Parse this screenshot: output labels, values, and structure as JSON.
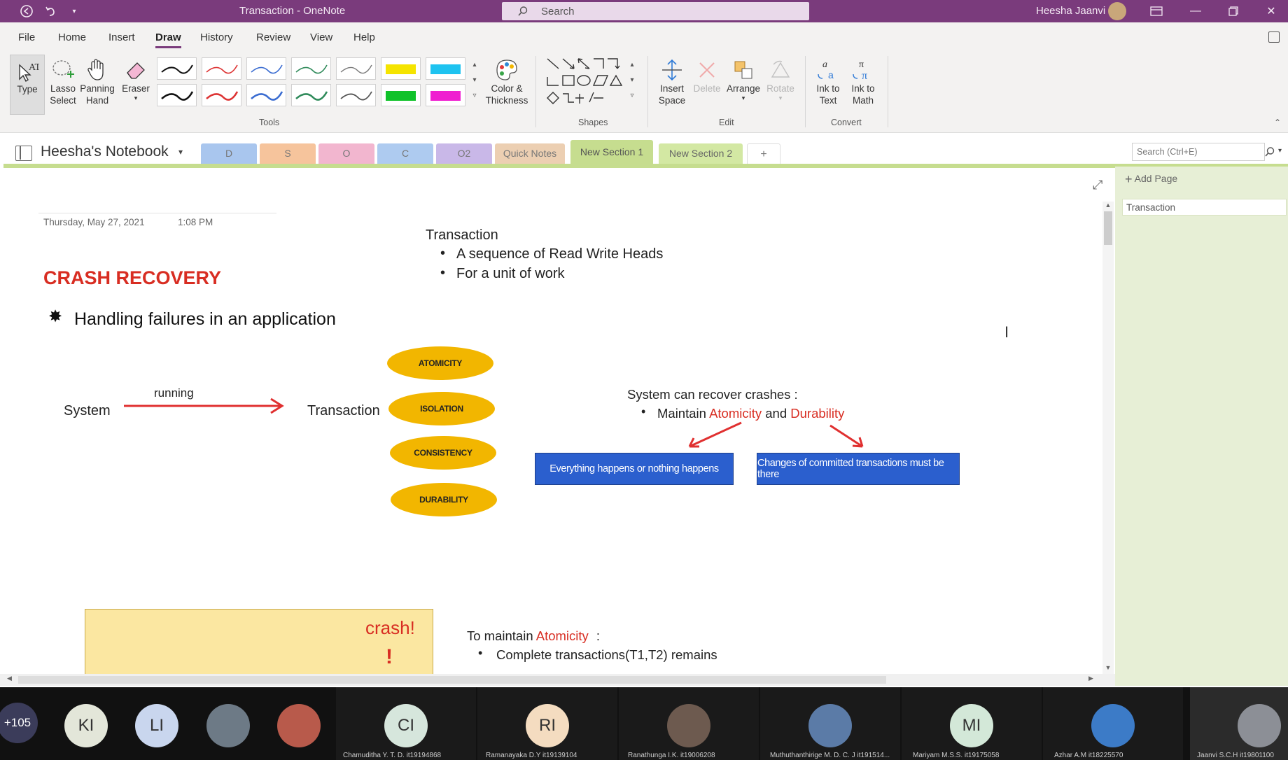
{
  "window": {
    "title": "Transaction - OneNote",
    "search_placeholder": "Search",
    "user_name": "Heesha Jaanvi"
  },
  "menu": [
    "File",
    "Home",
    "Insert",
    "Draw",
    "History",
    "Review",
    "View",
    "Help"
  ],
  "ribbon": {
    "type": "Type",
    "lasso_select": "Lasso Select",
    "panning_hand": "Panning Hand",
    "eraser": "Eraser",
    "color_thickness": "Color & Thickness",
    "insert_space": "Insert Space",
    "delete": "Delete",
    "arrange": "Arrange",
    "rotate": "Rotate",
    "ink_to_text": "Ink to Text",
    "ink_to_math": "Ink to Math",
    "groups": {
      "tools": "Tools",
      "shapes": "Shapes",
      "edit": "Edit",
      "convert": "Convert"
    }
  },
  "notebook": {
    "name": "Heesha's Notebook",
    "sections": [
      {
        "label": "D",
        "color": "#a9c6ee"
      },
      {
        "label": "S",
        "color": "#f6c49c"
      },
      {
        "label": "O",
        "color": "#f2b6cf"
      },
      {
        "label": "C",
        "color": "#aecbf0"
      },
      {
        "label": "O2",
        "color": "#c9b8e8"
      },
      {
        "label": "Quick Notes",
        "color": "#eccfb2"
      },
      {
        "label": "New Section 1",
        "color": "#c6dd8f"
      },
      {
        "label": "New Section 2",
        "color": "#d3e8a3"
      },
      {
        "label": "+",
        "color": "#ffffff"
      }
    ],
    "search_placeholder": "Search (Ctrl+E)"
  },
  "pages_pane": {
    "add_page": "Add Page",
    "pages": [
      "Transaction"
    ]
  },
  "note": {
    "date": "Thursday, May 27, 2021",
    "time": "1:08 PM",
    "title": "CRASH RECOVERY",
    "bullet_main": "Handling failures in an application",
    "transaction_heading": "Transaction",
    "transaction_bullets": [
      "A sequence of Read Write Heads",
      "For a unit of work"
    ],
    "system_label": "System",
    "running_label": "running",
    "transaction_label": "Transaction",
    "acid": [
      "ATOMICITY",
      "ISOLATION",
      "CONSISTENCY",
      "DURABILITY"
    ],
    "recover_heading": "System can recover crashes :",
    "maintain_prefix": "Maintain",
    "atomicity": "Atomicity",
    "and": "and",
    "durability": "Durability",
    "box_atomicity": "Everything happens or nothing happens",
    "box_durability": "Changes of committed transactions must be there",
    "crash_label": "crash!",
    "crash_mark": "!",
    "maintain_atomicity_prefix": "To maintain",
    "maintain_atomicity_word": "Atomicity",
    "maintain_atomicity_suffix": ":",
    "maintain_bullets": [
      "Complete transactions(T1,T2) remains"
    ]
  },
  "participants": {
    "more_count": "+105",
    "people": [
      {
        "initials": "KI",
        "name": "",
        "color": "#e3e6d9"
      },
      {
        "initials": "LI",
        "name": "",
        "color": "#c9d6ee"
      },
      {
        "initials": "",
        "name": "",
        "color": "#6d7a86"
      },
      {
        "initials": "",
        "name": "",
        "color": "#b85a4b"
      },
      {
        "initials": "CI",
        "name": "Chamuditha Y. T. D. it19194868",
        "color": "#d6e6dc"
      },
      {
        "initials": "RI",
        "name": "Ramanayaka D.Y it19139104",
        "color": "#f4dcc0"
      },
      {
        "initials": "",
        "name": "Ranathunga I.K. it19006208",
        "color": "#6d5a4f"
      },
      {
        "initials": "",
        "name": "Muthuthanthirige M. D. C. J it191514...",
        "color": "#5b7ba7"
      },
      {
        "initials": "MI",
        "name": "Mariyam M.S.S. it19175058",
        "color": "#d3e8d8"
      },
      {
        "initials": "",
        "name": "Azhar A.M it18225570",
        "color": "#3c7bc7"
      },
      {
        "initials": "",
        "name": "Jaanvi S.C.H it19801100",
        "color": "#8c8f96"
      }
    ]
  },
  "colors": {
    "accent": "#7a3b7c",
    "highlight_red": "#d82d22",
    "oval_yellow": "#f2b600",
    "box_blue": "#2b5fce",
    "section_green": "#c6dd8f"
  }
}
